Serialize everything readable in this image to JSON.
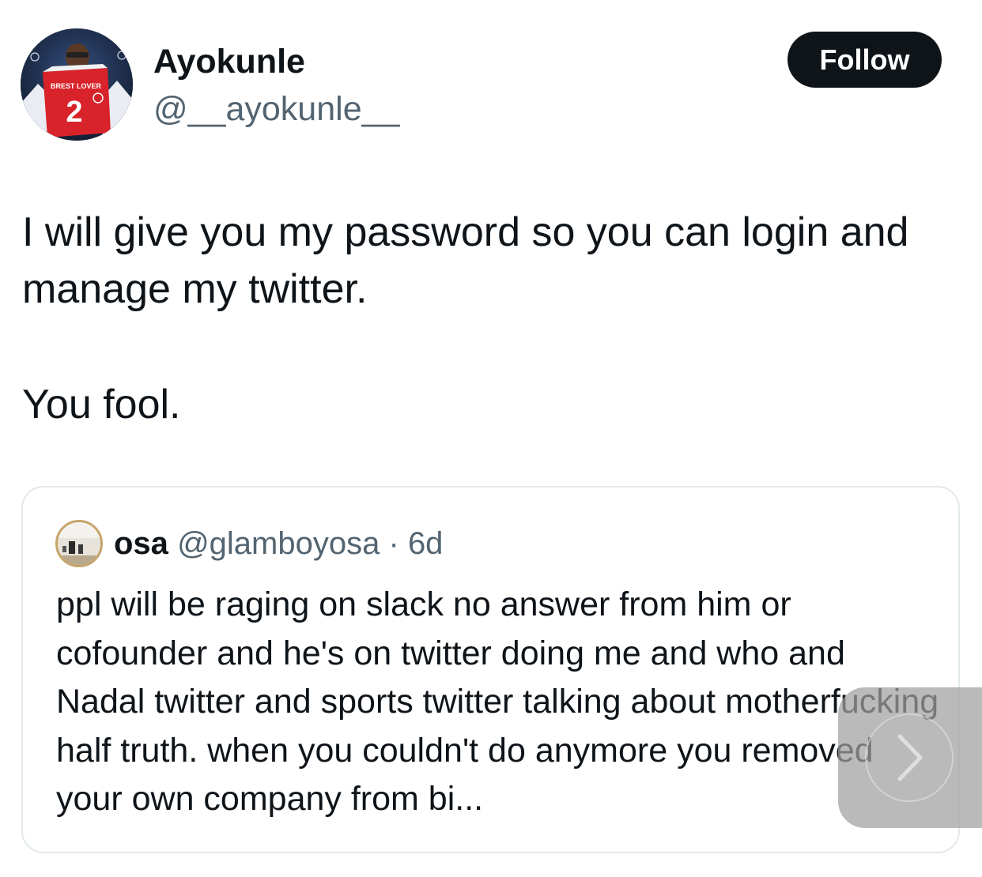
{
  "author": {
    "display_name": "Ayokunle",
    "handle": "@__ayokunle__",
    "avatar_icon": "avatar-photo"
  },
  "follow_button": {
    "label": "Follow"
  },
  "tweet": {
    "line1": "I will give you my password so you can login and manage my twitter.",
    "line2": "You fool."
  },
  "quoted_tweet": {
    "name": "osa",
    "handle": "@glamboyosa",
    "separator": "·",
    "time": "6d",
    "text": "ppl will be raging on slack no answer from him or cofounder and he's on twitter doing me and who and Nadal twitter and sports twitter talking about motherfucking half truth. when you couldn't do anymore you removed your own company from bi..."
  },
  "colors": {
    "primary_text": "#0f1419",
    "secondary_text": "#536471",
    "border": "#e1e8ed",
    "follow_bg": "#0f1419",
    "follow_text": "#ffffff"
  },
  "icons": {
    "next": "chevron-right-icon"
  }
}
